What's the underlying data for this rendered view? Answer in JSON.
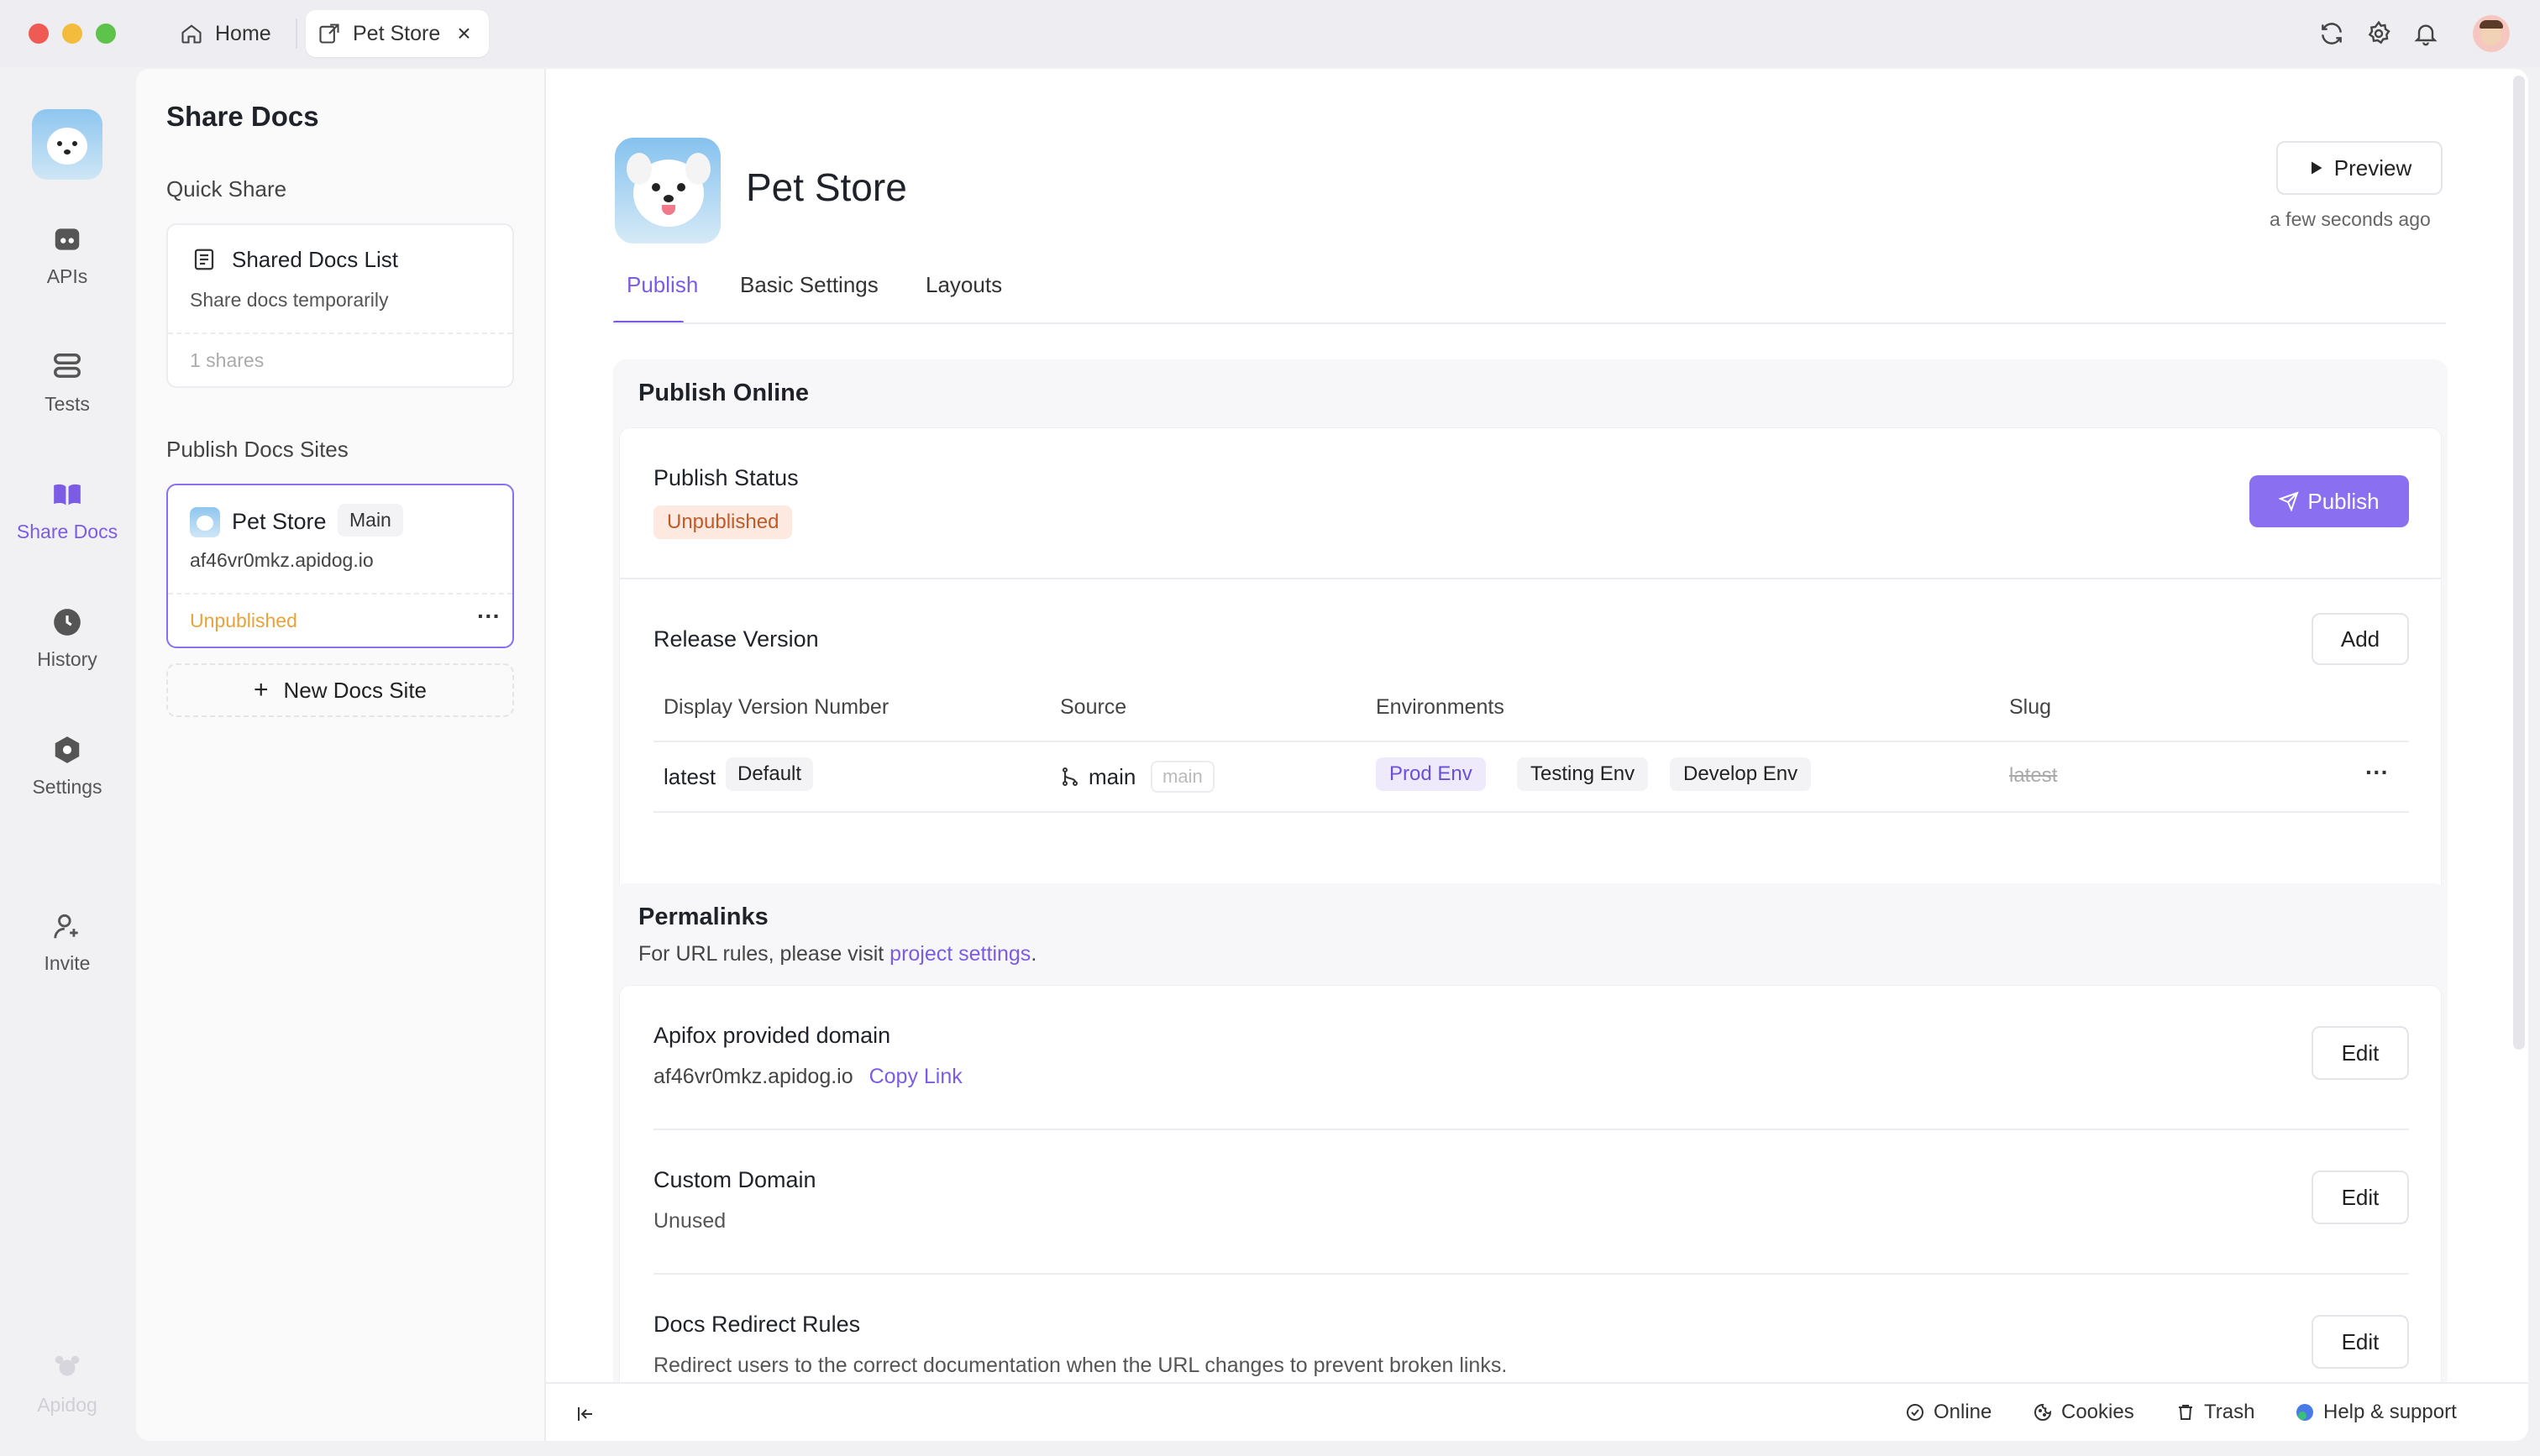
{
  "titlebar": {
    "tabs": [
      {
        "label": "Home",
        "icon": "home-icon"
      },
      {
        "label": "Pet Store",
        "icon": "share-icon",
        "close": "×"
      }
    ],
    "right_icons": [
      "refresh-icon",
      "gear-icon",
      "bell-icon",
      "avatar"
    ]
  },
  "leftnav": {
    "items": [
      {
        "label": "APIs",
        "icon": "api-icon"
      },
      {
        "label": "Tests",
        "icon": "tests-icon"
      },
      {
        "label": "Share Docs",
        "icon": "book-icon",
        "active": true
      },
      {
        "label": "History",
        "icon": "clock-icon"
      },
      {
        "label": "Settings",
        "icon": "settings-icon"
      },
      {
        "label": "Invite",
        "icon": "invite-icon"
      }
    ],
    "brand": "Apidog"
  },
  "sharepanel": {
    "title": "Share Docs",
    "quick_share_heading": "Quick Share",
    "shared_docs": {
      "title": "Shared Docs List",
      "subtitle": "Share docs temporarily",
      "count": "1 shares"
    },
    "sites_heading": "Publish Docs Sites",
    "site": {
      "name": "Pet Store",
      "branch": "Main",
      "domain": "af46vr0mkz.apidog.io",
      "status": "Unpublished",
      "more": "···"
    },
    "new_site": {
      "plus": "+",
      "label": "New Docs Site"
    }
  },
  "main": {
    "project_name": "Pet Store",
    "preview_label": "Preview",
    "updated": "a few seconds ago",
    "tabs": [
      "Publish",
      "Basic Settings",
      "Layouts"
    ],
    "publish_online": {
      "title": "Publish Online",
      "status_label": "Publish Status",
      "status": "Unpublished",
      "publish_button": "Publish",
      "release_label": "Release Version",
      "add_button": "Add",
      "columns": [
        "Display Version Number",
        "Source",
        "Environments",
        "Slug"
      ],
      "row": {
        "version": "latest",
        "default_badge": "Default",
        "source": "main",
        "source_tag": "main",
        "envs": [
          "Prod Env",
          "Testing Env",
          "Develop Env"
        ],
        "slug": "latest",
        "more": "···"
      }
    },
    "permalinks": {
      "title": "Permalinks",
      "desc_prefix": "For URL rules, please visit ",
      "desc_link": "project settings",
      "desc_suffix": ".",
      "items": [
        {
          "title": "Apifox provided domain",
          "value": "af46vr0mkz.apidog.io",
          "link": "Copy Link",
          "button": "Edit"
        },
        {
          "title": "Custom Domain",
          "value": "Unused",
          "button": "Edit"
        },
        {
          "title": "Docs Redirect Rules",
          "value": "Redirect users to the correct documentation when the URL changes to prevent broken links.",
          "button": "Edit"
        }
      ]
    }
  },
  "bottombar": {
    "collapse_icon": "collapse-icon",
    "items": [
      "Online",
      "Cookies",
      "Trash",
      "Help & support"
    ]
  },
  "colors": {
    "accent": "#7c5ce4",
    "warning_bg": "#fde9df",
    "warning_text": "#c05a2a",
    "unpublished_text": "#e8a23a"
  }
}
